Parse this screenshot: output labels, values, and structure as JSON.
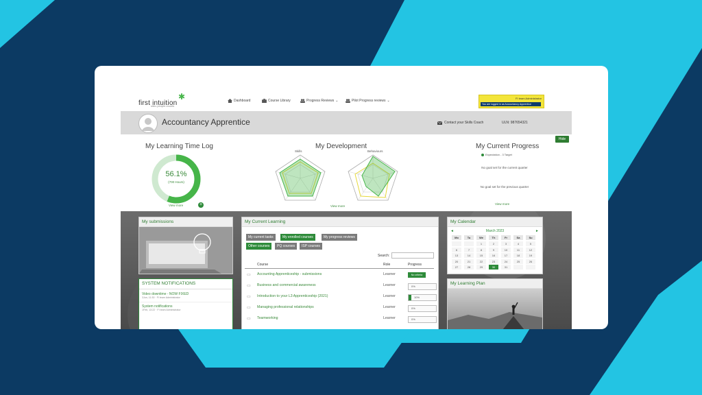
{
  "app": {
    "logo_text": "first intuition",
    "logo_sub": "sitec.people.counts"
  },
  "nav": {
    "dashboard": "Dashboard",
    "course_library": "Course Library",
    "progress_reviews": "Progress Reviews",
    "pilot_progress_reviews": "Pilot Progress reviews"
  },
  "admin": {
    "role": "FI team Administrator",
    "logged_in_as": "You are logged in as Accountancy Apprentice"
  },
  "header": {
    "title": "Accountancy Apprentice",
    "contact": "Contact your Skills Coach",
    "uln": "ULN: 987654321"
  },
  "hide_label": "Hide",
  "time_log": {
    "title": "My Learning Time Log",
    "percent_value": 56.1,
    "percent_text": "56.1%",
    "hours": "(700 Hours)",
    "view_more": "View more"
  },
  "development": {
    "title": "My Development",
    "skills": "Skills",
    "behaviours": "Behaviours",
    "view_more": "View more"
  },
  "progress": {
    "title": "My Current Progress",
    "legend": "Expectation - 3 Target",
    "no_goal_current": "No goal set for the current quarter",
    "no_goal_previous": "No goal set for the previous quarter",
    "view_more": "View more"
  },
  "submissions": {
    "title": "My submissions"
  },
  "notifications": {
    "title": "SYSTEM NOTIFICATIONS",
    "items": [
      {
        "title": "Video downtime - NOW FIXED",
        "meta": "3Jun, 11:30 · FI team Administrator"
      },
      {
        "title": "System notifications",
        "meta": "1Feb, 13:22 · FI team Administrator"
      }
    ]
  },
  "learning": {
    "title": "My Current Learning",
    "tabs_row1": [
      "My current tasks",
      "My enrolled courses",
      "My progress reviews"
    ],
    "tabs_row2": [
      "Other courses",
      "PQ courses",
      "ISP courses"
    ],
    "search_label": "Search:",
    "columns": {
      "course": "Course",
      "role": "Role",
      "progress": "Progress"
    },
    "courses": [
      {
        "name": "Accounting Apprenticeship - submissions",
        "role": "Learner",
        "progress_text": "No criteria",
        "fraction": null
      },
      {
        "name": "Business and commercial awareness",
        "role": "Learner",
        "progress_text": "0%",
        "fraction": 0
      },
      {
        "name": "Introduction to your L3 Apprenticeship (2021)",
        "role": "Learner",
        "progress_text": "10%",
        "fraction": 0.1
      },
      {
        "name": "Managing professional relationships",
        "role": "Learner",
        "progress_text": "0%",
        "fraction": 0
      },
      {
        "name": "Teamworking",
        "role": "Learner",
        "progress_text": "0%",
        "fraction": 0
      }
    ]
  },
  "calendar": {
    "title": "My Calendar",
    "month": "March 2023",
    "prev": "◄",
    "next": "►",
    "weekdays": [
      "Mo",
      "Tu",
      "We",
      "Th",
      "Fr",
      "Sa",
      "Su"
    ],
    "days": [
      "",
      "",
      "1",
      "2",
      "3",
      "4",
      "5",
      "6",
      "7",
      "8",
      "9",
      "10",
      "11",
      "12",
      "13",
      "14",
      "15",
      "16",
      "17",
      "18",
      "19",
      "20",
      "21",
      "22",
      "23",
      "24",
      "25",
      "26",
      "27",
      "28",
      "29",
      "30",
      "31",
      "",
      ""
    ],
    "today": "30"
  },
  "learning_plan": {
    "title": "My Learning Plan"
  },
  "colors": {
    "navy": "#0c3a63",
    "cyan": "#23c4e3",
    "green": "#2e8b3a",
    "donut": "#46b549"
  }
}
